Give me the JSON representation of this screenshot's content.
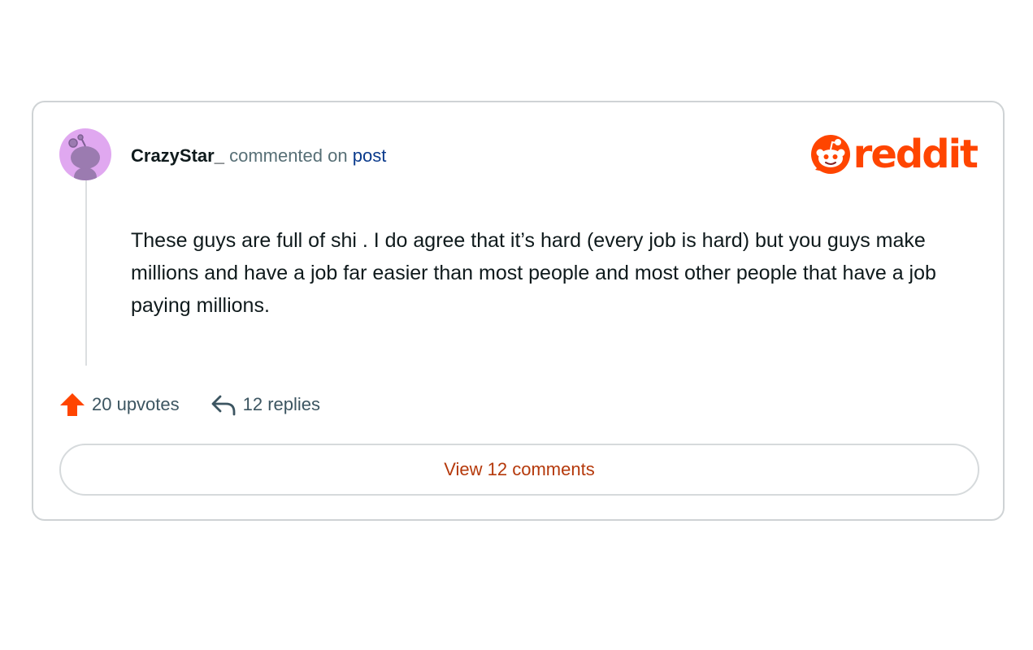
{
  "comment": {
    "username": "CrazyStar_",
    "action_text": "commented on",
    "post_link_label": "post",
    "body": "These guys are full of shi . I do agree that it’s hard (every job is hard) but you guys make millions and have a job far easier than most people and most other people that have a job paying millions.",
    "avatar_icon": "snoo-avatar-icon",
    "avatar_color": "#e0a8f0"
  },
  "logo": {
    "wordmark": "reddit",
    "icon": "reddit-snoo-icon",
    "brand_color": "#ff4500"
  },
  "actions": {
    "upvotes_label": "20 upvotes",
    "upvote_icon": "upvote-arrow-icon",
    "replies_label": "12 replies",
    "reply_icon": "reply-arrow-icon"
  },
  "footer": {
    "view_comments_label": "View 12 comments"
  }
}
